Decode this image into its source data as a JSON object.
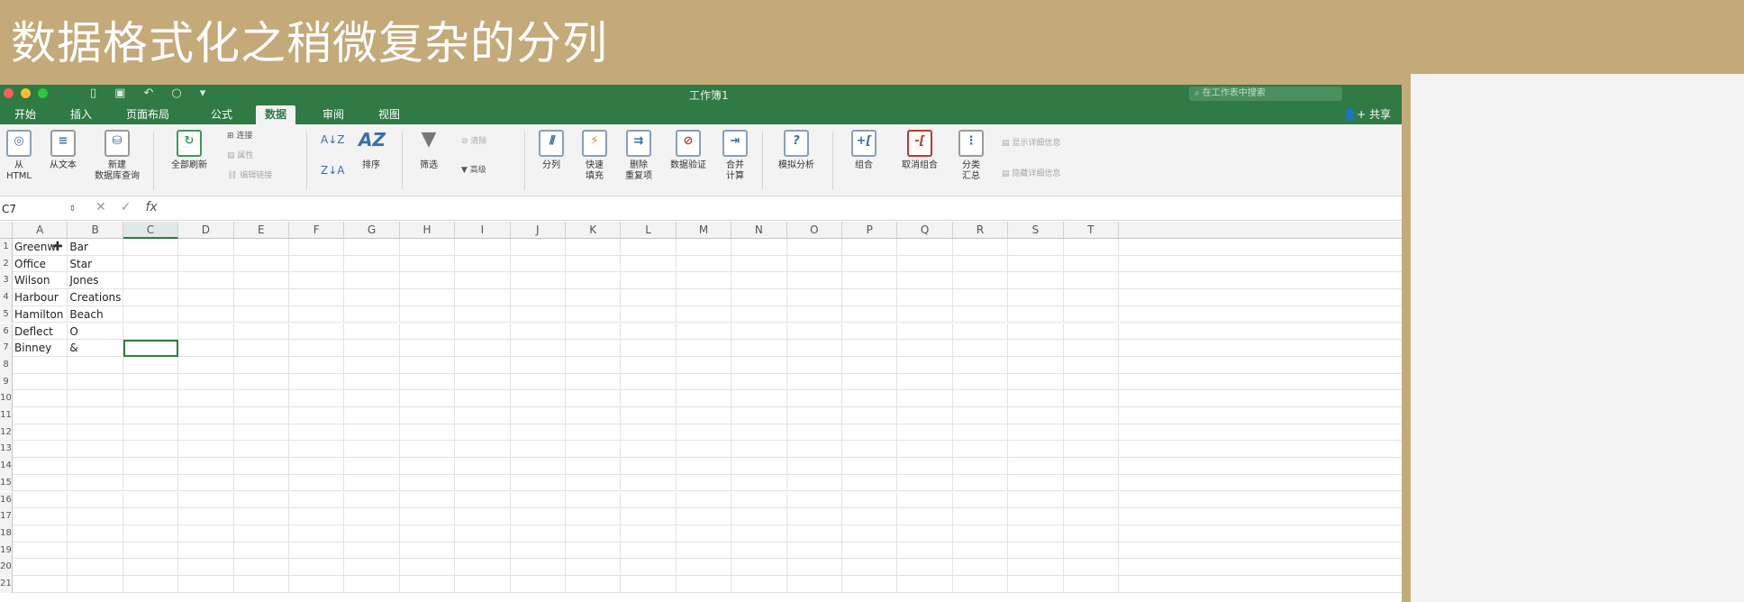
{
  "banner": {
    "title": "数据格式化之稍微复杂的分列"
  },
  "titlebar": {
    "workbook_title": "工作簿1",
    "search_placeholder": "在工作表中搜索"
  },
  "tabs": [
    {
      "label": "开始",
      "active": false
    },
    {
      "label": "插入",
      "active": false
    },
    {
      "label": "页面布局",
      "active": false
    },
    {
      "label": "公式",
      "active": false
    },
    {
      "label": "数据",
      "active": true
    },
    {
      "label": "审阅",
      "active": false
    },
    {
      "label": "视图",
      "active": false
    }
  ],
  "share_label": "共享",
  "ribbon": {
    "from_html": "从\nHTML",
    "from_text": "从文本",
    "new_db_query": "新建\n数据库查询",
    "refresh_all": "全部刷新",
    "connections": "连接",
    "properties": "属性",
    "edit_links": "编辑链接",
    "sort": "排序",
    "filter": "筛选",
    "clear": "清除",
    "advanced": "高级",
    "text_to_columns": "分列",
    "flash_fill": "快速\n填充",
    "remove_duplicates": "删除\n重复项",
    "data_validation": "数据验证",
    "consolidate": "合并\n计算",
    "what_if": "模拟分析",
    "group": "组合",
    "ungroup": "取消组合",
    "subtotal": "分类\n汇总",
    "show_detail": "显示详细信息",
    "hide_detail": "隐藏详细信息"
  },
  "formula_bar": {
    "name_box": "C7",
    "fx": "fx",
    "formula": ""
  },
  "sheet": {
    "columns": [
      "A",
      "B",
      "C",
      "D",
      "E",
      "F",
      "G",
      "H",
      "I",
      "J",
      "K",
      "L",
      "M",
      "N",
      "O",
      "P",
      "Q",
      "R",
      "S",
      "T"
    ],
    "selected_column": "C",
    "selected_cell": "C7",
    "rows": [
      [
        "Greenw",
        "Bar"
      ],
      [
        "Office",
        "Star"
      ],
      [
        "Wilson",
        "Jones"
      ],
      [
        "Harbour",
        "Creations"
      ],
      [
        "Hamilton",
        "Beach"
      ],
      [
        "Deflect",
        "O"
      ],
      [
        "Binney",
        "&"
      ]
    ],
    "row_numbers": [
      "1",
      "2",
      "3",
      "4",
      "5",
      "6",
      "7",
      "8",
      "9",
      "10",
      "11",
      "12",
      "13",
      "14",
      "15",
      "16",
      "17",
      "18",
      "19",
      "20",
      "21"
    ]
  },
  "colors": {
    "excel_green": "#2f7a45",
    "banner_gold": "#c4a979",
    "ribbon_bg": "#f3f3f3"
  }
}
